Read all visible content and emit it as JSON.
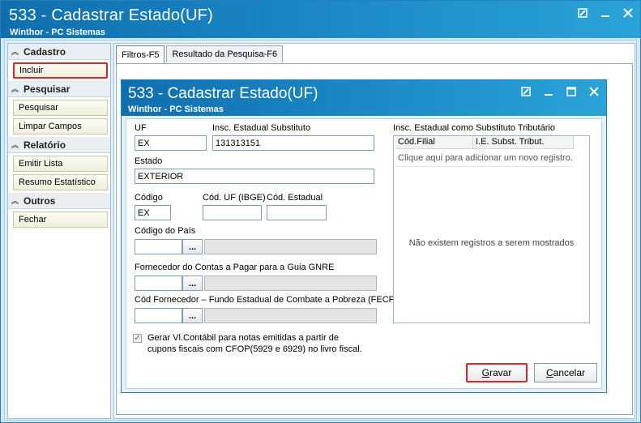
{
  "window": {
    "title": "533 - Cadastrar Estado(UF)",
    "subtitle": "Winthor - PC Sistemas"
  },
  "sidebar": {
    "groups": [
      {
        "label": "Cadastro",
        "items": [
          {
            "label": "Incluir"
          }
        ]
      },
      {
        "label": "Pesquisar",
        "items": [
          {
            "label": "Pesquisar"
          },
          {
            "label": "Limpar Campos"
          }
        ]
      },
      {
        "label": "Relatório",
        "items": [
          {
            "label": "Emitir Lista"
          },
          {
            "label": "Resumo Estatístico"
          }
        ]
      },
      {
        "label": "Outros",
        "items": [
          {
            "label": "Fechar"
          }
        ]
      }
    ]
  },
  "tabs": [
    {
      "label": "Filtros-F5"
    },
    {
      "label": "Resultado da Pesquisa-F6"
    }
  ],
  "dialog": {
    "title": "533 - Cadastrar Estado(UF)",
    "subtitle": "Winthor - PC Sistemas",
    "form": {
      "uf_label": "UF",
      "uf_value": "EX",
      "insc_label": "Insc. Estadual Substituto",
      "insc_value": "131313151",
      "estado_label": "Estado",
      "estado_value": "EXTERIOR",
      "codigo_label": "Código",
      "codigo_value": "EX",
      "cod_uf_ibge_label": "Cód. UF (IBGE)",
      "cod_uf_ibge_value": "",
      "cod_estadual_label": "Cód. Estadual",
      "cod_estadual_value": "",
      "cod_pais_label": "Código do País",
      "fornecedor_gnre_label": "Fornecedor do Contas a Pagar para a Guia GNRE",
      "fornecedor_fecp_label": "Cód Fornecedor – Fundo Estadual de Combate a Pobreza (FECP)",
      "lookup_btn": "...",
      "checkbox_line1": "Gerar Vl.Contábil para notas emitidas a partir de",
      "checkbox_line2": "cupons fiscais com CFOP(5929 e 6929) no livro fiscal."
    },
    "grid": {
      "title": "Insc. Estadual como Substituto Tributário",
      "col1": "Cód.Filial",
      "col2": "I.E. Subst. Tribut.",
      "add_row": "Clique aqui para adicionar um novo registro.",
      "empty": "Não existem registros a serem mostrados"
    },
    "buttons": {
      "save_pre": "",
      "save_key": "G",
      "save_post": "ravar",
      "cancel_pre": "",
      "cancel_key": "C",
      "cancel_post": "ancelar"
    }
  }
}
